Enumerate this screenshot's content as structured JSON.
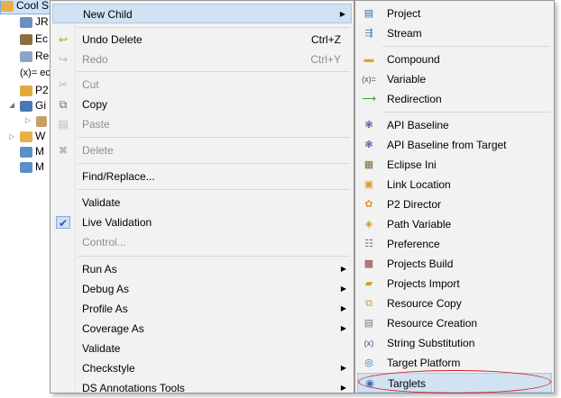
{
  "tree": {
    "items": [
      {
        "label": "Cool S",
        "color": "#e8b04a"
      },
      {
        "label": "JR",
        "color": "#6b8fbf"
      },
      {
        "label": "Ec",
        "color": "#8d6f3f"
      },
      {
        "label": "Re",
        "color": "#8aa6c4"
      },
      {
        "label": "(x)= ec",
        "color": "#ffffff"
      },
      {
        "label": "P2",
        "color": "#e2a93d"
      },
      {
        "label": "Gi",
        "color": "#4a78b4"
      },
      {
        "label": "",
        "color": "#c9a063"
      },
      {
        "label": "W",
        "color": "#e8b04a"
      },
      {
        "label": "M",
        "color": "#5b8fc9"
      },
      {
        "label": "M",
        "color": "#5b8fc9"
      }
    ]
  },
  "context_menu": {
    "new_child": "New Child",
    "undo_delete": "Undo Delete",
    "undo_shortcut": "Ctrl+Z",
    "redo": "Redo",
    "redo_shortcut": "Ctrl+Y",
    "cut": "Cut",
    "copy": "Copy",
    "paste": "Paste",
    "delete": "Delete",
    "find_replace": "Find/Replace...",
    "validate": "Validate",
    "live_validation": "Live Validation",
    "control": "Control...",
    "run_as": "Run As",
    "debug_as": "Debug As",
    "profile_as": "Profile As",
    "coverage_as": "Coverage As",
    "validate2": "Validate",
    "checkstyle": "Checkstyle",
    "ds_annotations": "DS Annotations Tools"
  },
  "submenu": {
    "items": [
      "Project",
      "Stream",
      "Compound",
      "Variable",
      "Redirection",
      "API Baseline",
      "API Baseline from Target",
      "Eclipse Ini",
      "Link Location",
      "P2 Director",
      "Path Variable",
      "Preference",
      "Projects Build",
      "Projects Import",
      "Resource Copy",
      "Resource Creation",
      "String Substitution",
      "Target Platform",
      "Targlets"
    ]
  },
  "colors": {
    "menu_bg": "#f2f2f2",
    "highlight": "#d1e2f2",
    "annotation_circle": "#d41d1d"
  }
}
